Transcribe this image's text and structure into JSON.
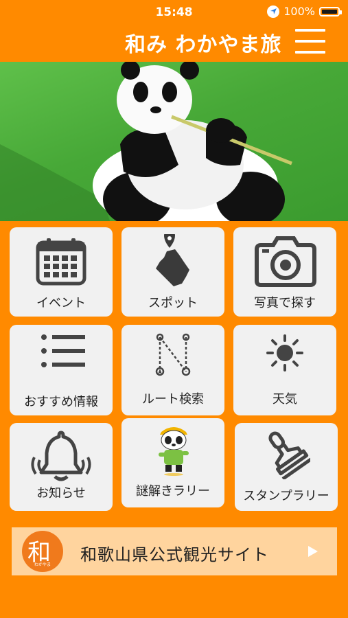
{
  "status_bar": {
    "time": "15:48",
    "battery": "100%"
  },
  "header": {
    "title": "和み わかやま旅"
  },
  "hero": {
    "alt": "panda-photo"
  },
  "menu": [
    {
      "label": "イベント",
      "icon": "calendar-icon"
    },
    {
      "label": "スポット",
      "icon": "map-pin-icon"
    },
    {
      "label": "写真で探す",
      "icon": "camera-icon"
    },
    {
      "label": "おすすめ情報",
      "icon": "list-icon"
    },
    {
      "label": "ルート検索",
      "icon": "route-icon"
    },
    {
      "label": "天気",
      "icon": "sun-icon"
    },
    {
      "label": "お知らせ",
      "icon": "bell-icon"
    },
    {
      "label": "謎解きラリー",
      "icon": "panda-mascot-icon"
    },
    {
      "label": "スタンプラリー",
      "icon": "stamp-icon"
    }
  ],
  "banner": {
    "text": "和歌山県公式観光サイト",
    "logo_char": "和",
    "logo_sub": "わかやま"
  },
  "colors": {
    "brand": "#ff8a00",
    "tile": "#f1f1f1",
    "banner": "#ffd49e",
    "icon": "#444444"
  }
}
